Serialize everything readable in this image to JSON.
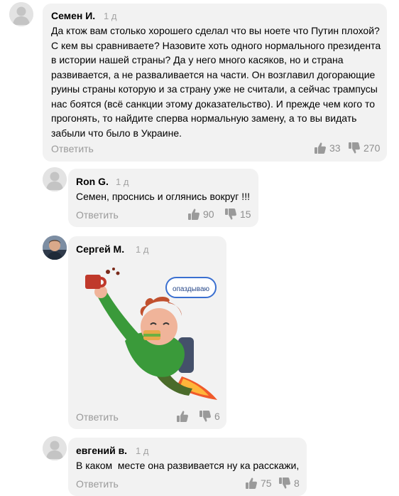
{
  "comments": [
    {
      "author": "Семен И.",
      "time": "1 д",
      "text_lines": [
        "Да ктож вам столько хорошего сделал что вы ноете что Путин плохой?",
        "С кем вы сравниваете? Назовите хоть одного нормального президента",
        "в истории нашей страны? Да у него много касяков, но и страна",
        "развивается, а не разваливается на части. Он возглавил догорающие",
        "руины страны которую и за страну уже не считали, а сейчас трампусы",
        "нас боятся (всё санкции этому доказательство). И прежде чем кого то",
        "прогонять, то найдите сперва нормальную замену, а то вы видать",
        "забыли что было в Украине."
      ],
      "reply_label": "Ответить",
      "likes": "33",
      "dislikes": "270"
    },
    {
      "author": "Ron G.",
      "time": "1 д",
      "text": "Семен, проснись и оглянись вокруг !!!",
      "reply_label": "Ответить",
      "likes": "90",
      "dislikes": "15"
    },
    {
      "author": "Сергей М.",
      "time": "1 д",
      "sticker_caption": "опаздываю",
      "reply_label": "Ответить",
      "likes": "",
      "dislikes": "6"
    },
    {
      "author": "евгений в.",
      "time": "1 д",
      "text": "В каком  месте она развивается ну ка расскажи,",
      "reply_label": "Ответить",
      "likes": "75",
      "dislikes": "8"
    }
  ],
  "icons": {
    "like": "thumbs-up-icon",
    "dislike": "thumbs-down-icon",
    "avatar_placeholder": "user-silhouette-icon"
  },
  "colors": {
    "bubble": "#f2f2f2",
    "meta_gray": "#a3a3a3",
    "action_gray": "#9a9a9a"
  }
}
